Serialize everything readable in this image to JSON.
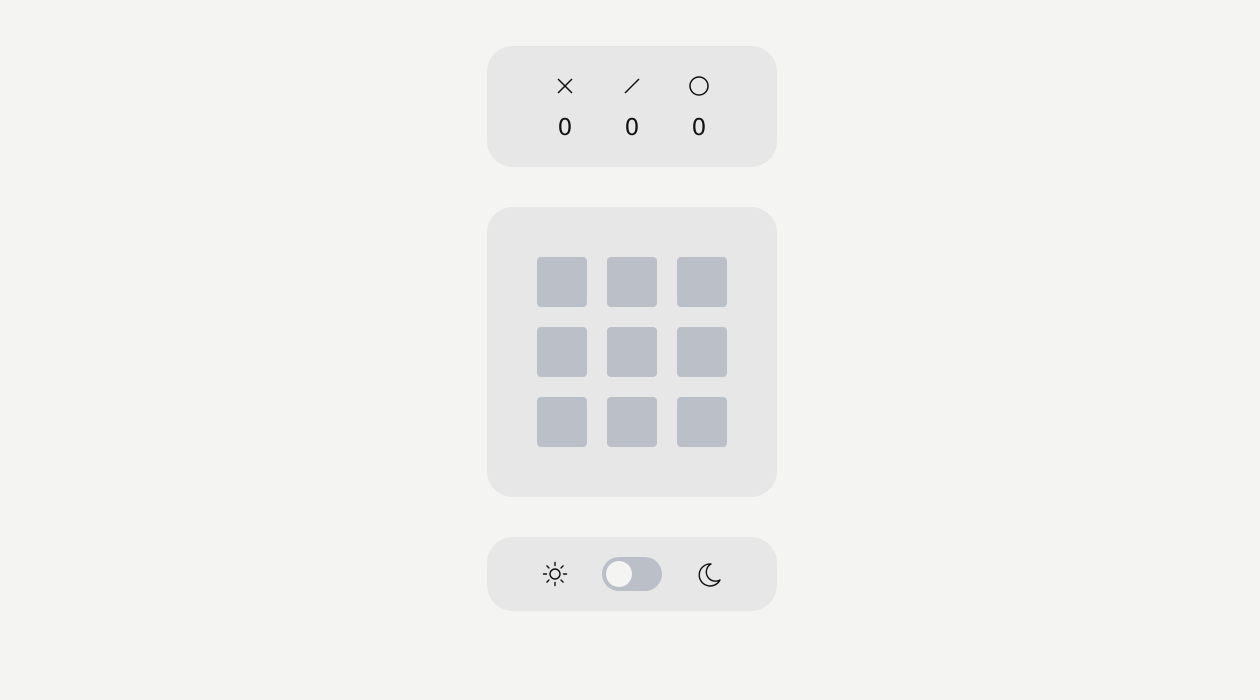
{
  "scoreboard": {
    "x_icon": "x-icon",
    "tie_icon": "slash-icon",
    "o_icon": "circle-icon",
    "x_score": "0",
    "ties": "0",
    "o_score": "0"
  },
  "board": {
    "cells": [
      "",
      "",
      "",
      "",
      "",
      "",
      "",
      "",
      ""
    ]
  },
  "theme": {
    "light_icon": "sun-icon",
    "dark_icon": "moon-icon",
    "toggle_state": "light"
  },
  "colors": {
    "background": "#f4f4f2",
    "panel": "#e7e7e7",
    "cell": "#bbbfc8",
    "text": "#111111"
  }
}
